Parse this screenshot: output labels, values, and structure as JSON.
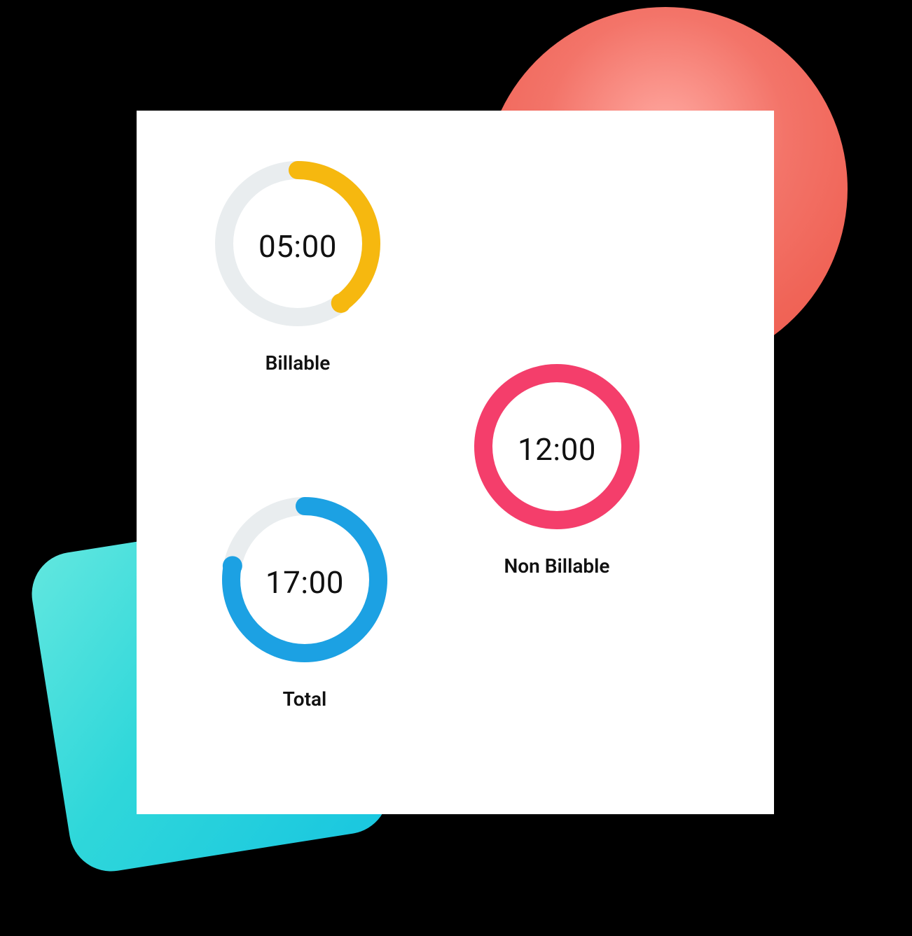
{
  "billable": {
    "label": "Billable",
    "value_text": "05:00",
    "hours": 5,
    "fraction": 0.4,
    "color": "#f6b80f",
    "track": "#e9edef"
  },
  "nonbillable": {
    "label": "Non Billable",
    "value_text": "12:00",
    "hours": 12,
    "fraction": 1.0,
    "color": "#f43e6b",
    "track": "#e9edef"
  },
  "total": {
    "label": "Total",
    "value_text": "17:00",
    "hours": 17,
    "fraction": 0.78,
    "color": "#1ca1e3",
    "track": "#e9edef"
  },
  "chart_data": {
    "type": "pie",
    "title": "",
    "series": [
      {
        "name": "Billable",
        "value_text": "05:00",
        "hours": 5,
        "fill_fraction": 0.4,
        "color": "#f6b80f"
      },
      {
        "name": "Non Billable",
        "value_text": "12:00",
        "hours": 12,
        "fill_fraction": 1.0,
        "color": "#f43e6b"
      },
      {
        "name": "Total",
        "value_text": "17:00",
        "hours": 17,
        "fill_fraction": 0.78,
        "color": "#1ca1e3"
      }
    ]
  }
}
